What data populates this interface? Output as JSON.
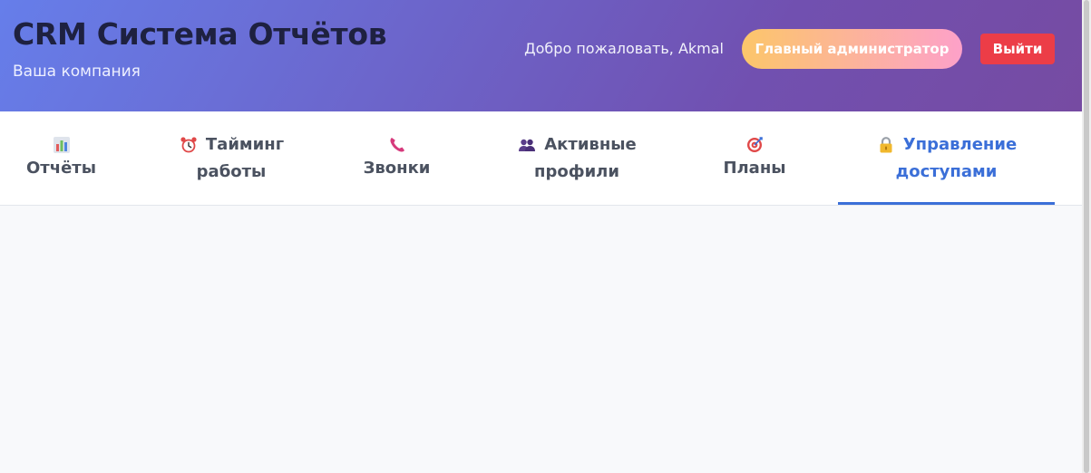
{
  "header": {
    "title": "CRM Система Отчётов",
    "subtitle": "Ваша компания",
    "welcome": "Добро пожаловать, Akmal",
    "role": "Главный администратор",
    "logout": "Выйти"
  },
  "tabs": [
    {
      "line1": "",
      "line2": "Отчёты",
      "icon": "bar-chart-icon"
    },
    {
      "line1": "Тайминг",
      "line2": "работы",
      "icon": "alarm-clock-icon"
    },
    {
      "line1": "",
      "line2": "Звонки",
      "icon": "phone-icon"
    },
    {
      "line1": "Активные",
      "line2": "профили",
      "icon": "users-icon"
    },
    {
      "line1": "",
      "line2": "Планы",
      "icon": "target-icon"
    },
    {
      "line1": "Управление",
      "line2": "доступами",
      "icon": "lock-icon",
      "active": true
    }
  ],
  "colors": {
    "header_gradient_start": "#667eea",
    "header_gradient_end": "#764ba2",
    "active_tab": "#3b6fd8",
    "logout": "#ec3d47",
    "role_gradient_start": "#fcc66a",
    "role_gradient_end": "#fda1c9"
  }
}
